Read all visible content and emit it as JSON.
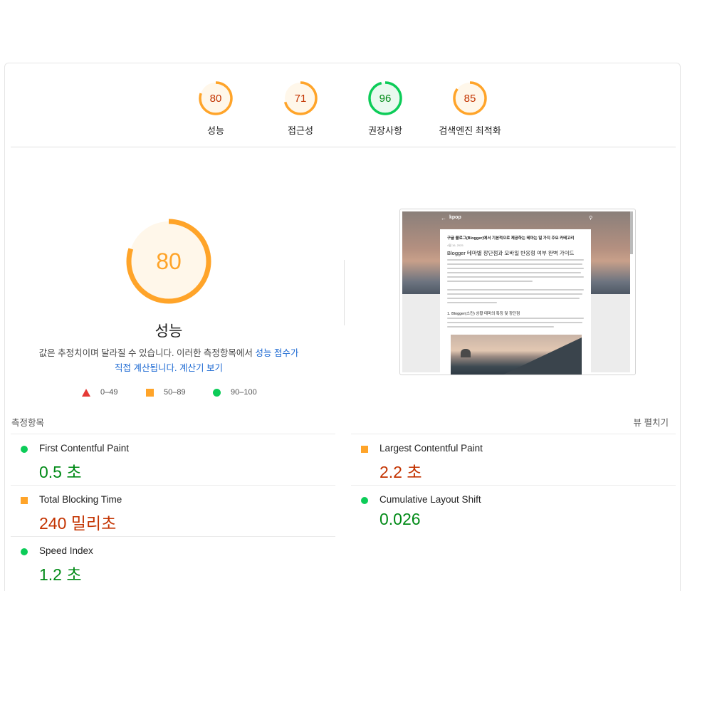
{
  "categories": [
    {
      "label": "성능",
      "score": 80,
      "ring_color": "#ffa429",
      "text_color": "#c33300",
      "fill": "#fff7ea"
    },
    {
      "label": "접근성",
      "score": 71,
      "ring_color": "#ffa429",
      "text_color": "#c33300",
      "fill": "#fff7ea"
    },
    {
      "label": "권장사항",
      "score": 96,
      "ring_color": "#0ccc58",
      "text_color": "#008a16",
      "fill": "#e9f9ef"
    },
    {
      "label": "검색엔진 최적화",
      "score": 85,
      "ring_color": "#ffa429",
      "text_color": "#c33300",
      "fill": "#fff7ea"
    }
  ],
  "main_gauge": {
    "score": 80,
    "label": "성능",
    "ring_color": "#ffa429",
    "text_color": "#ffa429"
  },
  "description": {
    "text1": "값은 추정치이며 달라질 수 있습니다. 이러한 측정항목에서 ",
    "link1": "성능 점수가",
    "link2": "직접 계산됩니다.",
    "link3": "계산기 보기"
  },
  "legend": {
    "fail": "0–49",
    "average": "50–89",
    "pass": "90–100"
  },
  "preview": {
    "brand": "kpop",
    "post_title": "구글 블로그(Blogger)에서 기본적으로 제공하는 테마는 일 가지 주요 카테고리",
    "post_date": "4월 16, 2025",
    "heading": "Blogger 테마별 장단점과 모바일 반응형 여부 완벽 가이드",
    "subheading": "1. Blogger(스킨) 상황 테마의 특징 및 장단점"
  },
  "metrics_section": {
    "title": "측정항목",
    "expand_label": "뷰 펼치기"
  },
  "metrics": [
    {
      "name": "First Contentful Paint",
      "value": "0.5 초",
      "status": "good"
    },
    {
      "name": "Largest Contentful Paint",
      "value": "2.2 초",
      "status": "avg"
    },
    {
      "name": "Total Blocking Time",
      "value": "240 밀리초",
      "status": "avg"
    },
    {
      "name": "Cumulative Layout Shift",
      "value": "0.026",
      "status": "good"
    },
    {
      "name": "Speed Index",
      "value": "1.2 초",
      "status": "good"
    }
  ]
}
